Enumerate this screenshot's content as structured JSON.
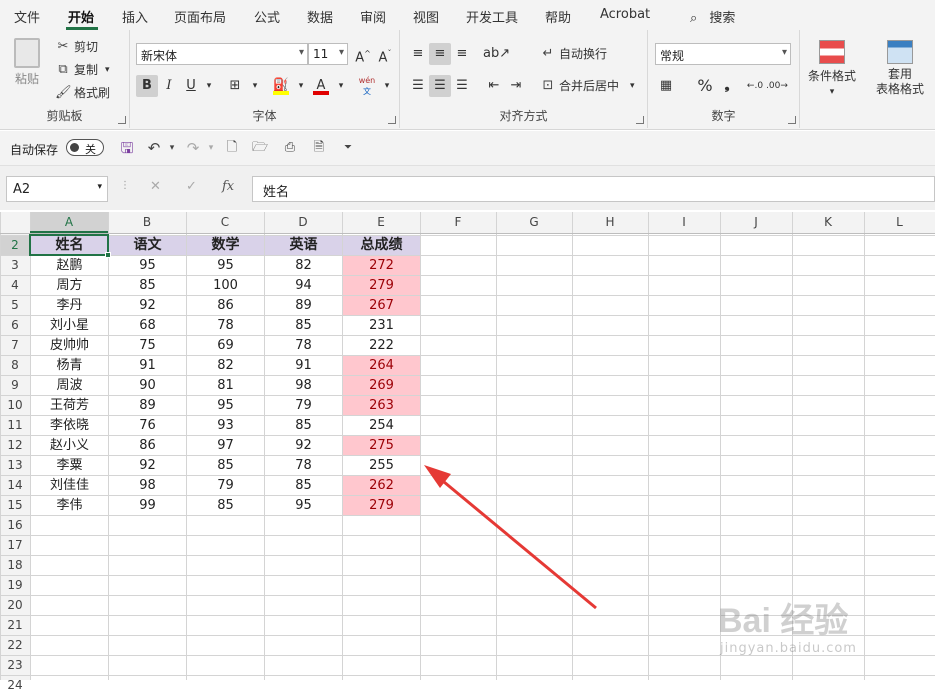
{
  "ribbon_tabs": [
    "文件",
    "开始",
    "插入",
    "页面布局",
    "公式",
    "数据",
    "审阅",
    "视图",
    "开发工具",
    "帮助",
    "Acrobat"
  ],
  "active_tab": "开始",
  "search_label": "搜索",
  "clipboard": {
    "paste": "粘贴",
    "cut": "剪切",
    "copy": "复制",
    "format_painter": "格式刷",
    "label": "剪贴板"
  },
  "font": {
    "name": "新宋体",
    "size": "11",
    "label": "字体",
    "bold": "B",
    "italic": "I",
    "underline": "U",
    "phonetic": "wén"
  },
  "alignment": {
    "wrap": "自动换行",
    "merge": "合并后居中",
    "label": "对齐方式"
  },
  "number": {
    "format": "常规",
    "label": "数字"
  },
  "styles": {
    "conditional": "条件格式",
    "table": "套用\n表格格式"
  },
  "qat": {
    "autosave_label": "自动保存",
    "autosave_state": "关"
  },
  "formula_bar": {
    "name_box": "A2",
    "fx": "fx",
    "content": "姓名"
  },
  "columns": [
    "A",
    "B",
    "C",
    "D",
    "E",
    "F",
    "G",
    "H",
    "I",
    "J",
    "K",
    "L"
  ],
  "row_numbers": [
    "2",
    "3",
    "4",
    "5",
    "6",
    "7",
    "8",
    "9",
    "10",
    "11",
    "12",
    "13",
    "14",
    "15",
    "16",
    "17",
    "18",
    "19",
    "20",
    "21",
    "22",
    "23",
    "24"
  ],
  "table_header": [
    "姓名",
    "语文",
    "数学",
    "英语",
    "总成绩"
  ],
  "rows": [
    {
      "name": "赵鹏",
      "chinese": "95",
      "math": "95",
      "english": "82",
      "total": "272",
      "hl": true
    },
    {
      "name": "周方",
      "chinese": "85",
      "math": "100",
      "english": "94",
      "total": "279",
      "hl": true
    },
    {
      "name": "李丹",
      "chinese": "92",
      "math": "86",
      "english": "89",
      "total": "267",
      "hl": true
    },
    {
      "name": "刘小星",
      "chinese": "68",
      "math": "78",
      "english": "85",
      "total": "231",
      "hl": false
    },
    {
      "name": "皮帅帅",
      "chinese": "75",
      "math": "69",
      "english": "78",
      "total": "222",
      "hl": false
    },
    {
      "name": "杨青",
      "chinese": "91",
      "math": "82",
      "english": "91",
      "total": "264",
      "hl": true
    },
    {
      "name": "周波",
      "chinese": "90",
      "math": "81",
      "english": "98",
      "total": "269",
      "hl": true
    },
    {
      "name": "王荷芳",
      "chinese": "89",
      "math": "95",
      "english": "79",
      "total": "263",
      "hl": true
    },
    {
      "name": "李依晓",
      "chinese": "76",
      "math": "93",
      "english": "85",
      "total": "254",
      "hl": false
    },
    {
      "name": "赵小义",
      "chinese": "86",
      "math": "97",
      "english": "92",
      "total": "275",
      "hl": true
    },
    {
      "name": "李粟",
      "chinese": "92",
      "math": "85",
      "english": "78",
      "total": "255",
      "hl": false
    },
    {
      "name": "刘佳佳",
      "chinese": "98",
      "math": "79",
      "english": "85",
      "total": "262",
      "hl": true
    },
    {
      "name": "李伟",
      "chinese": "99",
      "math": "85",
      "english": "95",
      "total": "279",
      "hl": true
    }
  ],
  "colors": {
    "header_fill": "#d9d2e9",
    "highlight_fill": "#ffc7ce",
    "highlight_text": "#9c0006",
    "arrow": "#e53935",
    "accent": "#217346"
  },
  "watermark": {
    "brand": "Bai 经验",
    "url": "jingyan.baidu.com"
  }
}
